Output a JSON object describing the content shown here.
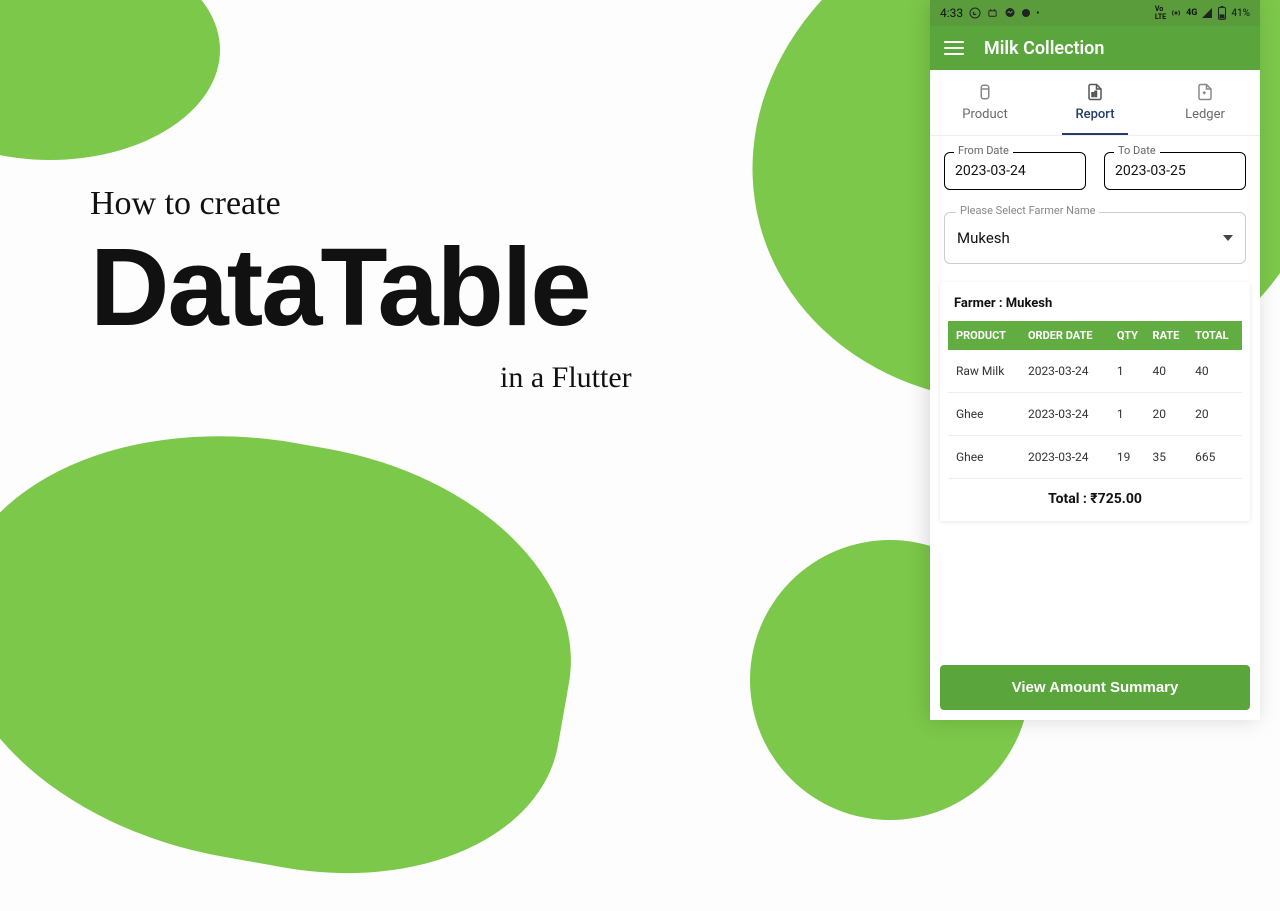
{
  "title": {
    "line1": "How to create",
    "main": "DataTable",
    "line3": "in a Flutter"
  },
  "phone": {
    "status": {
      "time": "4:33",
      "battery": "41%",
      "network": "4G"
    },
    "app_title": "Milk Collection",
    "tabs": {
      "product": "Product",
      "report": "Report",
      "ledger": "Ledger"
    },
    "form": {
      "from_label": "From Date",
      "from_value": "2023-03-24",
      "to_label": "To Date",
      "to_value": "2023-03-25",
      "farmer_label": "Please Select Farmer Name",
      "farmer_value": "Mukesh"
    },
    "result": {
      "farmer_heading": "Farmer : Mukesh",
      "columns": [
        "PRODUCT",
        "ORDER DATE",
        "QTY",
        "RATE",
        "TOTAL"
      ],
      "rows": [
        {
          "product": "Raw Milk",
          "date": "2023-03-24",
          "qty": "1",
          "rate": "40",
          "total": "40"
        },
        {
          "product": "Ghee",
          "date": "2023-03-24",
          "qty": "1",
          "rate": "20",
          "total": "20"
        },
        {
          "product": "Ghee",
          "date": "2023-03-24",
          "qty": "19",
          "rate": "35",
          "total": "665"
        }
      ],
      "total_label": "Total : ₹725.00"
    },
    "button": "View Amount Summary"
  }
}
